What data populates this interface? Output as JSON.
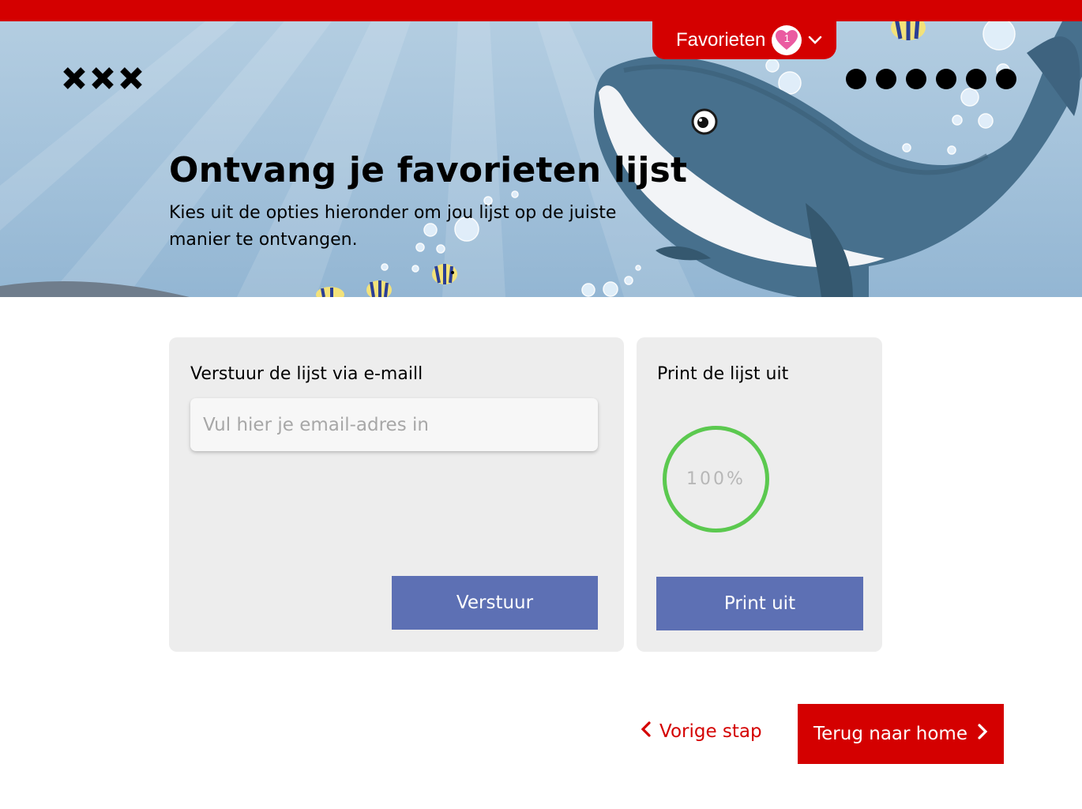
{
  "header": {
    "favorites_label": "Favorieten",
    "favorites_count": "1",
    "favorites_icon": "heart-icon",
    "dropdown_icon": "chevron-down-icon",
    "logo_icon": "xxx-logo-icon",
    "brand_color": "#d40000"
  },
  "hero": {
    "title": "Ontvang je favorieten lijst",
    "subtitle": "Kies uit de opties hieronder om jou lijst op de juiste manier te ontvangen."
  },
  "email_card": {
    "title": "Verstuur de lijst via e-maill",
    "input_value": "",
    "input_placeholder": "Vul hier je email-adres in",
    "button_label": "Verstuur"
  },
  "print_card": {
    "title": "Print de lijst uit",
    "progress_value": 1.0,
    "progress_label": "100%",
    "progress_color": "#5bc94f",
    "button_label": "Print uit"
  },
  "footer": {
    "back_label": "Vorige stap",
    "back_icon": "chevron-left-icon",
    "home_label": "Terug naar home",
    "home_icon": "chevron-right-icon"
  },
  "colors": {
    "accent_red": "#d40000",
    "button_blue": "#5d70b4",
    "card_gray": "#ededed"
  }
}
